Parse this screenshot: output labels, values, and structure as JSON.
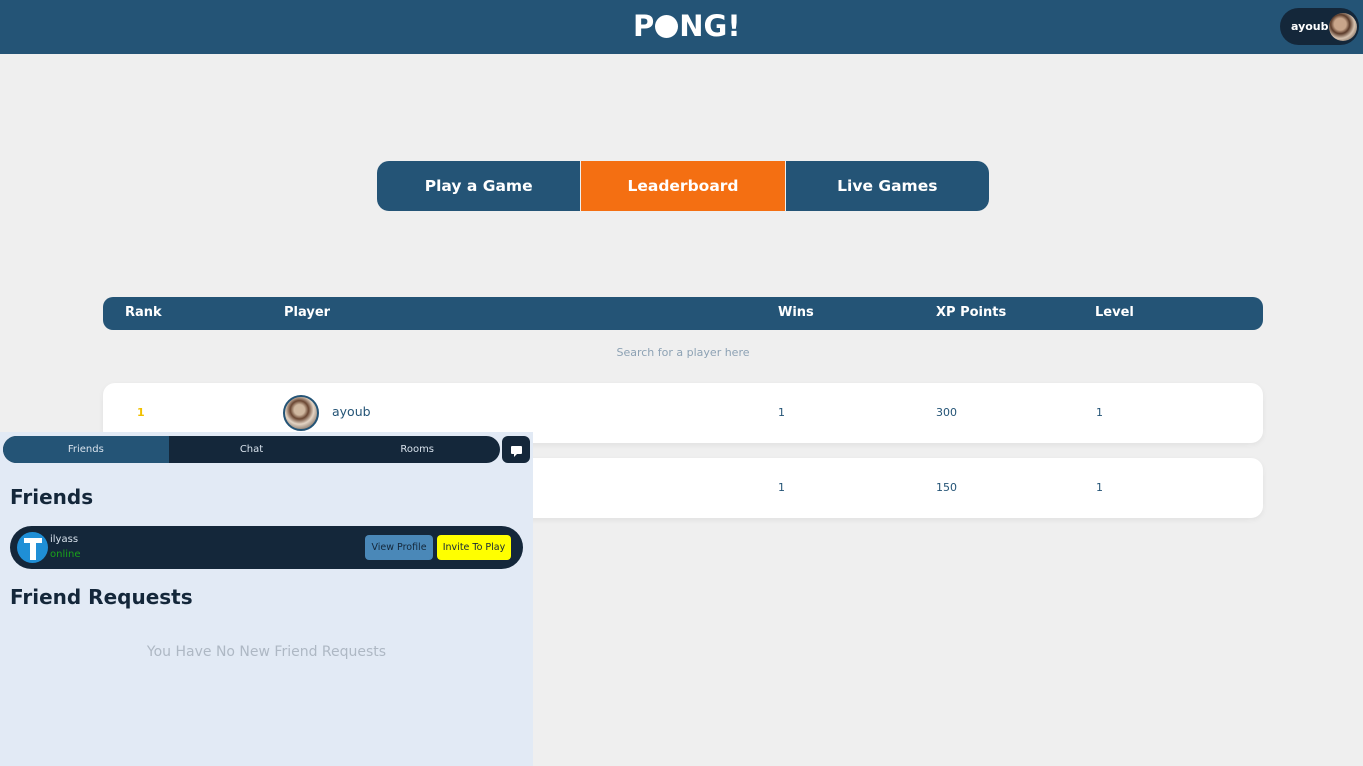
{
  "header": {
    "logo_text_1": "P",
    "logo_text_2": "NG!",
    "username": "ayoub"
  },
  "tabs": [
    {
      "label": "Play a Game",
      "active": false
    },
    {
      "label": "Leaderboard",
      "active": true
    },
    {
      "label": "Live Games",
      "active": false
    }
  ],
  "leaderboard": {
    "columns": [
      "Rank",
      "Player",
      "Wins",
      "XP Points",
      "Level"
    ],
    "search_placeholder": "Search for a player here",
    "rows": [
      {
        "rank": "1",
        "player": "ayoub",
        "wins": "1",
        "xp": "300",
        "level": "1"
      },
      {
        "rank": "",
        "player": "",
        "wins": "1",
        "xp": "150",
        "level": "1"
      }
    ]
  },
  "panel": {
    "tabs": [
      "Friends",
      "Chat",
      "Rooms"
    ],
    "friends_heading": "Friends",
    "friends": [
      {
        "name": "ilyass",
        "status": "online",
        "view_label": "View Profile",
        "invite_label": "Invite To Play"
      }
    ],
    "requests_heading": "Friend Requests",
    "requests_empty": "You Have No New Friend Requests"
  },
  "colors": {
    "primary": "#245476",
    "accent": "#f46f12",
    "dark": "#14273a",
    "invite": "#ffff00",
    "online": "#1aa21a"
  }
}
